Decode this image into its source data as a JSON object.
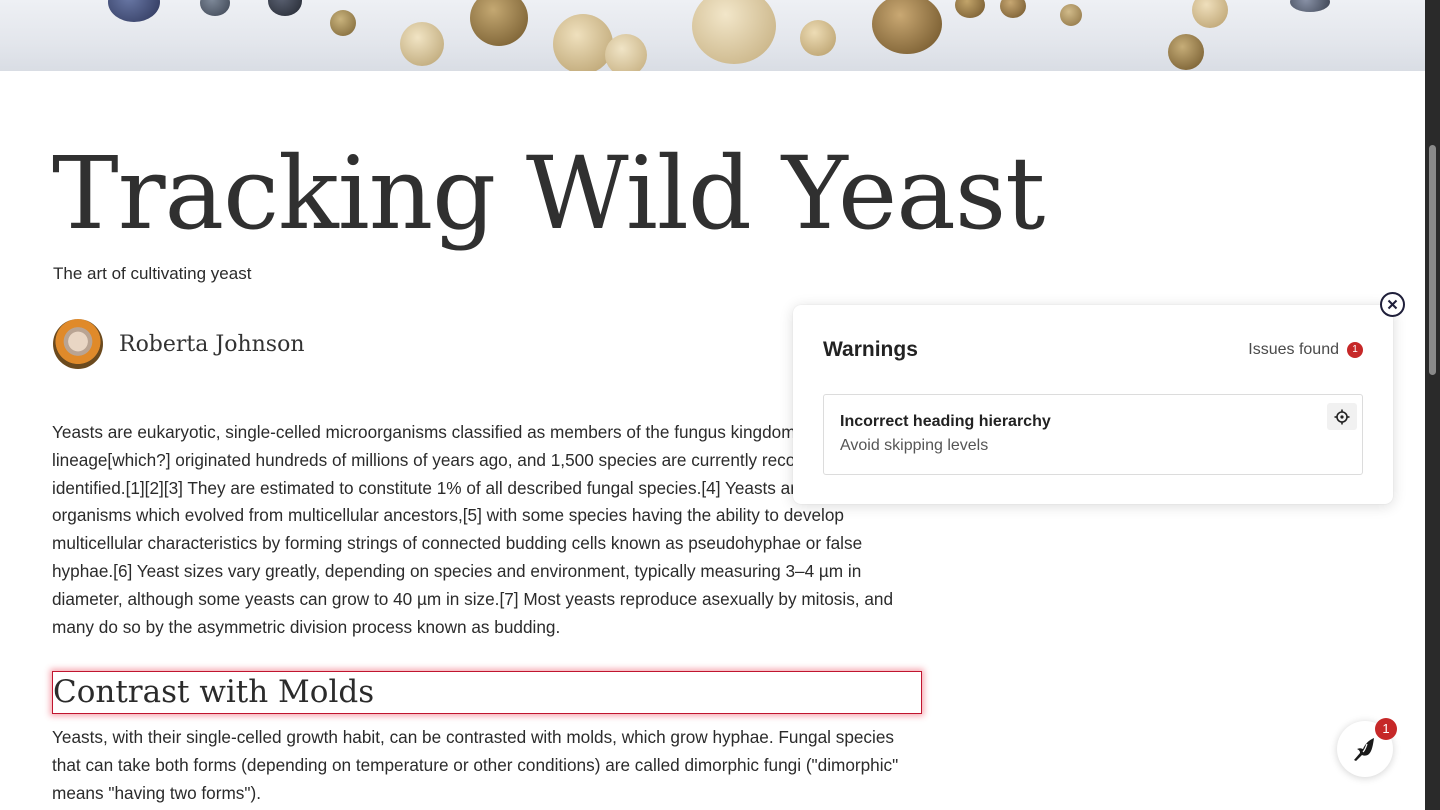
{
  "hero": {
    "image": "yeast-balls-photo"
  },
  "article": {
    "title": "Tracking Wild Yeast",
    "subtitle": "The art of cultivating yeast",
    "author": {
      "name": "Roberta Johnson",
      "avatar": "author-avatar-photo"
    },
    "paragraph1": "Yeasts are eukaryotic, single-celled microorganisms classified as members of the fungus kingdom. The first yeast lineage[which?] originated hundreds of millions of years ago, and 1,500 species are currently recognized as identified.[1][2][3] They are estimated to constitute 1% of all described fungal species.[4] Yeasts are unicellular organisms which evolved from multicellular ancestors,[5] with some species having the ability to develop multicellular characteristics by forming strings of connected budding cells known as pseudohyphae or false hyphae.[6] Yeast sizes vary greatly, depending on species and environment, typically measuring 3–4 µm in diameter, although some yeasts can grow to 40 µm in size.[7] Most yeasts reproduce asexually by mitosis, and many do so by the asymmetric division process known as budding.",
    "heading2": "Contrast with Molds",
    "paragraph2": "Yeasts, with their single-celled growth habit, can be contrasted with molds, which grow hyphae. Fungal species that can take both forms (depending on temperature or other conditions) are called dimorphic fungi (\"dimorphic\" means \"having two forms\")."
  },
  "warnings_panel": {
    "title": "Warnings",
    "issues_label": "Issues found",
    "issues_count": "1",
    "issues": [
      {
        "title": "Incorrect heading hierarchy",
        "description": "Avoid skipping levels"
      }
    ]
  },
  "fab": {
    "badge": "1",
    "icon": "bird-icon"
  },
  "colors": {
    "highlight": "#c0152f",
    "badge": "#c62828"
  }
}
